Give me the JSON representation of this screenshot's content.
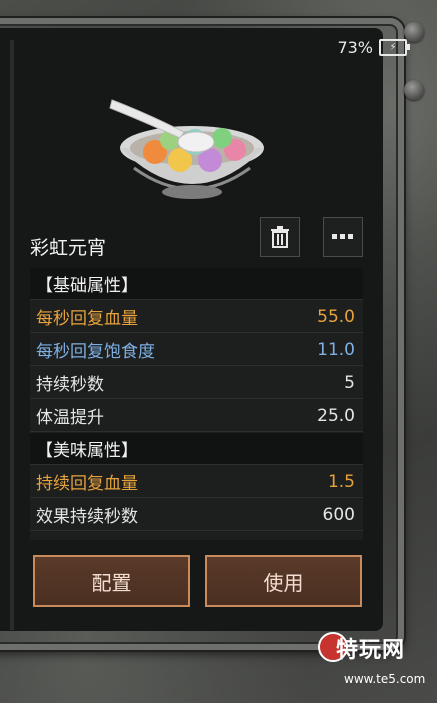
{
  "status": {
    "battery_percent": "73%"
  },
  "item": {
    "name": "彩虹元宵",
    "image_icon": "rainbow-yuanxiao-bowl-icon"
  },
  "actions": {
    "delete_icon": "trash-icon",
    "more_icon": "ellipsis-icon"
  },
  "sections": {
    "base_title": "【基础属性】",
    "taste_title": "【美味属性】"
  },
  "rows": [
    {
      "label": "每秒回复血量",
      "value": "55.0",
      "color": "#e7a33d"
    },
    {
      "label": "每秒回复饱食度",
      "value": "11.0",
      "color": "#7fb0e3"
    },
    {
      "label": "持续秒数",
      "value": "5",
      "color": "#e5e5e5"
    },
    {
      "label": "体温提升",
      "value": "25.0",
      "color": "#e5e5e5"
    },
    {
      "label": "持续回复血量",
      "value": "1.5",
      "color": "#e7a33d"
    },
    {
      "label": "效果持续秒数",
      "value": "600",
      "color": "#e5e5e5"
    }
  ],
  "buttons": {
    "config": "配置",
    "use": "使用"
  },
  "watermark": {
    "title": "特玩网",
    "url": "www.te5.com"
  },
  "colors": {
    "accent_orange": "#e7a33d",
    "accent_blue": "#7fb0e3",
    "button_border": "#c98a5c"
  }
}
